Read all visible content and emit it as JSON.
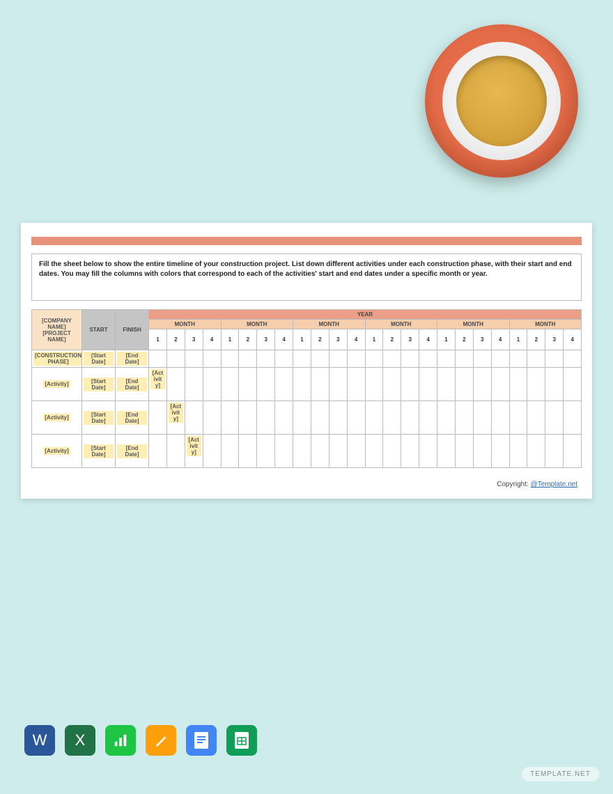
{
  "instruction": "Fill the sheet below to show the entire timeline of your construction project. List down different activities under each construction phase, with their start and end dates. You may fill the columns with colors that correspond to each of the activities' start and end dates under a specific month or year.",
  "headers": {
    "company": "[COMPANY NAME]",
    "project": "[PROJECT NAME]",
    "start": "START",
    "finish": "FINISH",
    "year": "YEAR",
    "month": "MONTH",
    "weeks": [
      "1",
      "2",
      "3",
      "4"
    ]
  },
  "rows": [
    {
      "label": "[CONSTRUCTION PHASE]",
      "start": "[Start Date]",
      "end": "[End Date]",
      "bar_col": null,
      "bar_text": ""
    },
    {
      "label": "[Activity]",
      "start": "[Start Date]",
      "end": "[End Date]",
      "bar_col": 0,
      "bar_text": "[Activity]"
    },
    {
      "label": "[Activity]",
      "start": "[Start Date]",
      "end": "[End Date]",
      "bar_col": 1,
      "bar_text": "[Activity]"
    },
    {
      "label": "[Activity]",
      "start": "[Start Date]",
      "end": "[End Date]",
      "bar_col": 2,
      "bar_text": "[Activity]"
    }
  ],
  "num_months": 6,
  "copyright_label": "Copyright: ",
  "copyright_link": "@Template.net",
  "watermark": "TEMPLATE.NET",
  "apps": [
    "word",
    "excel",
    "numbers",
    "pages",
    "docs",
    "sheets"
  ]
}
